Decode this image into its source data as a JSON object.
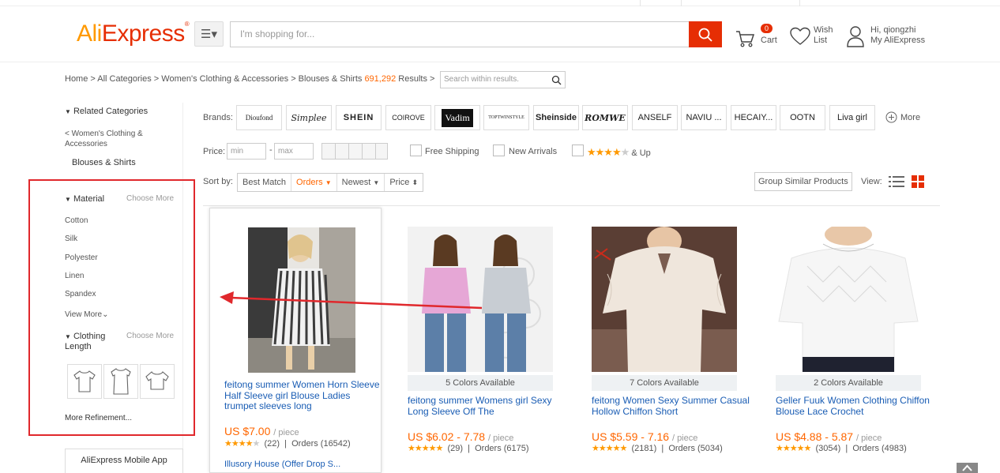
{
  "header": {
    "logo_ali": "Ali",
    "logo_express": "Express",
    "logo_tm": "®",
    "search_placeholder": "I'm shopping for...",
    "cart_count": "0",
    "cart_label": "Cart",
    "wish_line1": "Wish",
    "wish_line2": "List",
    "account_line1": "Hi, qiongzhi",
    "account_line2": "My AliExpress"
  },
  "breadcrumb": {
    "text": "Home > All Categories > Women's Clothing & Accessories > Blouses & Shirts",
    "count": "691,292",
    "results": "Results >",
    "within_placeholder": "Search within results."
  },
  "sidebar": {
    "related_title": "Related Categories",
    "parent_cat": "< Women's Clothing & Accessories",
    "current_cat": "Blouses & Shirts",
    "material_title": "Material",
    "choose_more": "Choose More",
    "materials": [
      "Cotton",
      "Silk",
      "Polyester",
      "Linen",
      "Spandex"
    ],
    "view_more": "View More",
    "length_title": "Clothing Length",
    "more_refinement": "More Refinement...",
    "mobile_app": "AliExpress Mobile App"
  },
  "filters": {
    "brands_label": "Brands:",
    "brands": [
      "Dioufond",
      "Simplee",
      "SHEIN",
      "COIROVE",
      "Vadim",
      "TOPTWINSTYLE",
      "Sheinside",
      "ROMWE",
      "ANSELF",
      "NAVIU ...",
      "HECAIY...",
      "OOTN",
      "Liva girl"
    ],
    "more_label": "More",
    "price_label": "Price:",
    "min_placeholder": "min",
    "max_placeholder": "max",
    "price_dash": "-",
    "free_shipping": "Free Shipping",
    "new_arrivals": "New Arrivals",
    "and_up": "& Up",
    "rating_filter_value": 4
  },
  "sort": {
    "label": "Sort by:",
    "options": [
      "Best Match",
      "Orders",
      "Newest",
      "Price"
    ],
    "active": "Orders",
    "group_similar": "Group Similar Products",
    "view_label": "View:"
  },
  "products": [
    {
      "title": "feitong summer Women Horn Sleeve Half Sleeve girl Blouse Ladies trumpet sleeves long",
      "price": "US $7.00",
      "unit": "/ piece",
      "rating": 4,
      "reviews": "(22)",
      "orders": "Orders (16542)",
      "store": "Illusory House (Offer Drop S...",
      "colors": ""
    },
    {
      "title": "feitong summer Womens girl Sexy Long Sleeve Off The",
      "price": "US $6.02 - 7.78",
      "unit": "/ piece",
      "rating": 4.5,
      "reviews": "(29)",
      "orders": "Orders (6175)",
      "colors": "5 Colors Available"
    },
    {
      "title": "feitong Women Sexy Summer Casual Hollow Chiffon Short",
      "price": "US $5.59 - 7.16",
      "unit": "/ piece",
      "rating": 5,
      "reviews": "(2181)",
      "orders": "Orders (5034)",
      "colors": "7 Colors Available"
    },
    {
      "title": "Geller Fuuk Women Clothing Chiffon Blouse Lace Crochet",
      "price": "US $4.88 - 5.87",
      "unit": "/ piece",
      "rating": 4.5,
      "reviews": "(3054)",
      "orders": "Orders (4983)",
      "colors": "2 Colors Available"
    }
  ],
  "colors": {
    "accent": "#e62e04",
    "orange": "#ff6600",
    "link": "#1a5db4",
    "highlight": "#e0282c"
  }
}
